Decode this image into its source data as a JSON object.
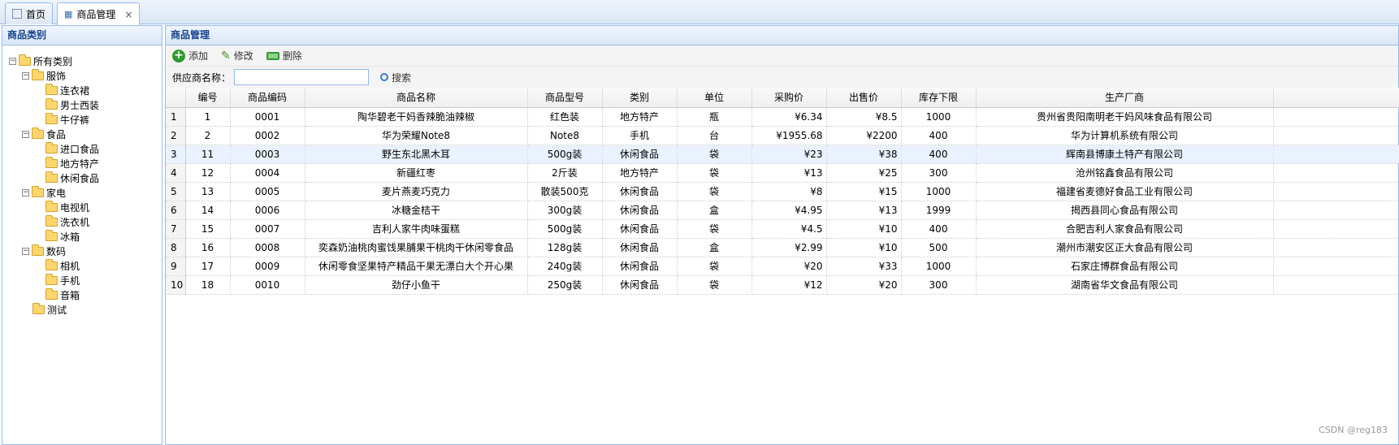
{
  "tabs": [
    {
      "label": "首页",
      "icon": "home-icon"
    },
    {
      "label": "商品管理",
      "icon": "tree-icon",
      "close": "×"
    }
  ],
  "left_panel": {
    "title": "商品类别",
    "tree": [
      {
        "label": "所有类别",
        "level": 0,
        "expanded": true
      },
      {
        "label": "服饰",
        "level": 1,
        "expanded": true
      },
      {
        "label": "连衣裙",
        "level": 2
      },
      {
        "label": "男士西装",
        "level": 2
      },
      {
        "label": "牛仔裤",
        "level": 2
      },
      {
        "label": "食品",
        "level": 1,
        "expanded": true
      },
      {
        "label": "进口食品",
        "level": 2
      },
      {
        "label": "地方特产",
        "level": 2
      },
      {
        "label": "休闲食品",
        "level": 2
      },
      {
        "label": "家电",
        "level": 1,
        "expanded": true
      },
      {
        "label": "电视机",
        "level": 2
      },
      {
        "label": "洗衣机",
        "level": 2
      },
      {
        "label": "冰箱",
        "level": 2
      },
      {
        "label": "数码",
        "level": 1,
        "expanded": true
      },
      {
        "label": "相机",
        "level": 2
      },
      {
        "label": "手机",
        "level": 2
      },
      {
        "label": "音箱",
        "level": 2
      },
      {
        "label": "测试",
        "level": 1
      }
    ]
  },
  "main_panel": {
    "title": "商品管理",
    "toolbar": {
      "add": "添加",
      "edit": "修改",
      "delete": "删除"
    },
    "search": {
      "label": "供应商名称：",
      "value": "",
      "button": "搜索"
    },
    "columns": [
      "编号",
      "商品编码",
      "商品名称",
      "商品型号",
      "类别",
      "单位",
      "采购价",
      "出售价",
      "库存下限",
      "生产厂商"
    ],
    "rows": [
      [
        "1",
        "0001",
        "陶华碧老干妈香辣脆油辣椒",
        "红色装",
        "地方特产",
        "瓶",
        "¥6.34",
        "¥8.5",
        "1000",
        "贵州省贵阳南明老干妈风味食品有限公司"
      ],
      [
        "2",
        "0002",
        "华为荣耀Note8",
        "Note8",
        "手机",
        "台",
        "¥1955.68",
        "¥2200",
        "400",
        "华为计算机系统有限公司"
      ],
      [
        "11",
        "0003",
        "野生东北黑木耳",
        "500g装",
        "休闲食品",
        "袋",
        "¥23",
        "¥38",
        "400",
        "辉南县博康土特产有限公司"
      ],
      [
        "12",
        "0004",
        "新疆红枣",
        "2斤装",
        "地方特产",
        "袋",
        "¥13",
        "¥25",
        "300",
        "沧州铭鑫食品有限公司"
      ],
      [
        "13",
        "0005",
        "麦片燕麦巧克力",
        "散装500克",
        "休闲食品",
        "袋",
        "¥8",
        "¥15",
        "1000",
        "福建省麦德好食品工业有限公司"
      ],
      [
        "14",
        "0006",
        "冰糖金桔干",
        "300g装",
        "休闲食品",
        "盒",
        "¥4.95",
        "¥13",
        "1999",
        "揭西县同心食品有限公司"
      ],
      [
        "15",
        "0007",
        "吉利人家牛肉味蛋糕",
        "500g装",
        "休闲食品",
        "袋",
        "¥4.5",
        "¥10",
        "400",
        "合肥吉利人家食品有限公司"
      ],
      [
        "16",
        "0008",
        "奕森奶油桃肉蜜饯果脯果干桃肉干休闲零食品",
        "128g装",
        "休闲食品",
        "盒",
        "¥2.99",
        "¥10",
        "500",
        "潮州市潮安区正大食品有限公司"
      ],
      [
        "17",
        "0009",
        "休闲零食坚果特产精品干果无漂白大个开心果",
        "240g装",
        "休闲食品",
        "袋",
        "¥20",
        "¥33",
        "1000",
        "石家庄博群食品有限公司"
      ],
      [
        "18",
        "0010",
        "劲仔小鱼干",
        "250g装",
        "休闲食品",
        "袋",
        "¥12",
        "¥20",
        "300",
        "湖南省华文食品有限公司"
      ]
    ],
    "row_numbers": [
      "1",
      "2",
      "3",
      "4",
      "5",
      "6",
      "7",
      "8",
      "9",
      "10"
    ],
    "selected_row": 3
  },
  "watermark": "CSDN @reg183"
}
